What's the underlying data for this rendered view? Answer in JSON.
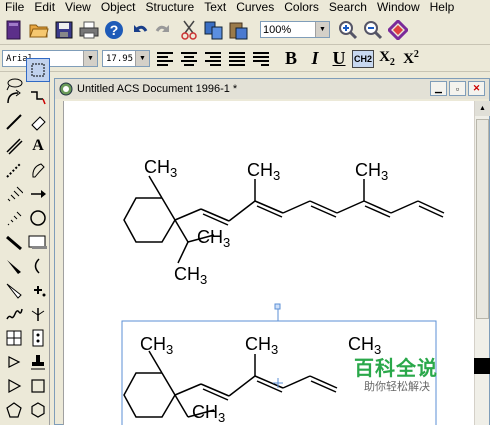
{
  "menu": [
    "File",
    "Edit",
    "View",
    "Object",
    "Structure",
    "Text",
    "Curves",
    "Colors",
    "Search",
    "Window",
    "Help"
  ],
  "toolbar": {
    "zoom_value": "100%",
    "font_name": "Arial",
    "font_size": "17.95",
    "bold_label": "B",
    "italic_label": "I",
    "underline_label": "U",
    "ch2_label": "CH2",
    "subscript_label": "X2",
    "superscript_label": "X2"
  },
  "document": {
    "title": "Untitled ACS Document 1996-1 *"
  },
  "molecule1": {
    "labels": [
      "CH3",
      "CH3",
      "CH3",
      "CH3",
      "CH3"
    ]
  },
  "molecule2": {
    "labels": [
      "CH3",
      "CH3",
      "CH3",
      "CH3"
    ]
  },
  "watermark": {
    "title": "百科全说",
    "subtitle": "助你轻松解决"
  },
  "colors": {
    "selection": "#5b8fd6",
    "watermark_green": "#2aa84a"
  }
}
